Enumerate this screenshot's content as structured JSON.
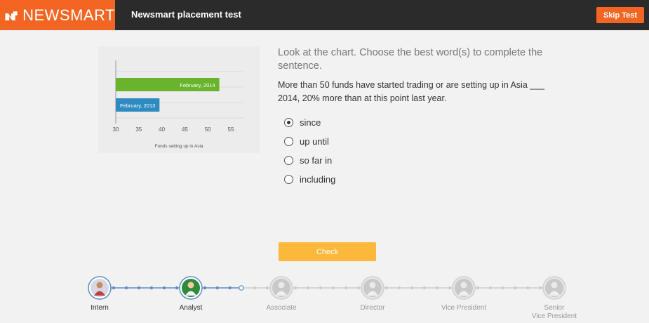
{
  "header": {
    "brand": "NEWSMART",
    "title": "Newsmart placement test",
    "skip_label": "Skip Test",
    "brand_color": "#f26522"
  },
  "chart_data": {
    "type": "bar",
    "orientation": "horizontal",
    "categories": [
      "February, 2014",
      "February, 2013"
    ],
    "values": [
      52.5,
      39.5
    ],
    "colors": [
      "#6ab42d",
      "#2e8bc0"
    ],
    "xlabel": "Funds setting up in Asia",
    "xticks": [
      30,
      35,
      40,
      45,
      50,
      55
    ],
    "xlim": [
      30,
      55
    ],
    "grid": true
  },
  "question": {
    "instruction": "Look at the chart. Choose the best word(s) to complete the sentence.",
    "sentence": "More than 50 funds have started trading or are setting up in Asia ___ 2014, 20% more than at this point last year.",
    "options": [
      {
        "label": "since",
        "selected": true
      },
      {
        "label": "up until",
        "selected": false
      },
      {
        "label": "so far in",
        "selected": false
      },
      {
        "label": "including",
        "selected": false
      }
    ],
    "check_label": "Check",
    "check_color": "#fcb83b"
  },
  "progress": {
    "levels": [
      {
        "label": "Intern",
        "icon": "intern-avatar-icon",
        "state": "done"
      },
      {
        "label": "Analyst",
        "icon": "analyst-avatar-icon",
        "state": "current"
      },
      {
        "label": "Associate",
        "icon": "associate-avatar-icon",
        "state": "locked"
      },
      {
        "label": "Director",
        "icon": "director-avatar-icon",
        "state": "locked"
      },
      {
        "label": "Vice President",
        "icon": "vice-president-avatar-icon",
        "state": "locked"
      },
      {
        "label": "Senior Vice President",
        "label_line1": "Senior",
        "label_line2": "Vice President",
        "icon": "senior-vice-president-avatar-icon",
        "state": "locked"
      }
    ],
    "active_color": "#5b8fc7",
    "inactive_color": "#cccccc"
  }
}
